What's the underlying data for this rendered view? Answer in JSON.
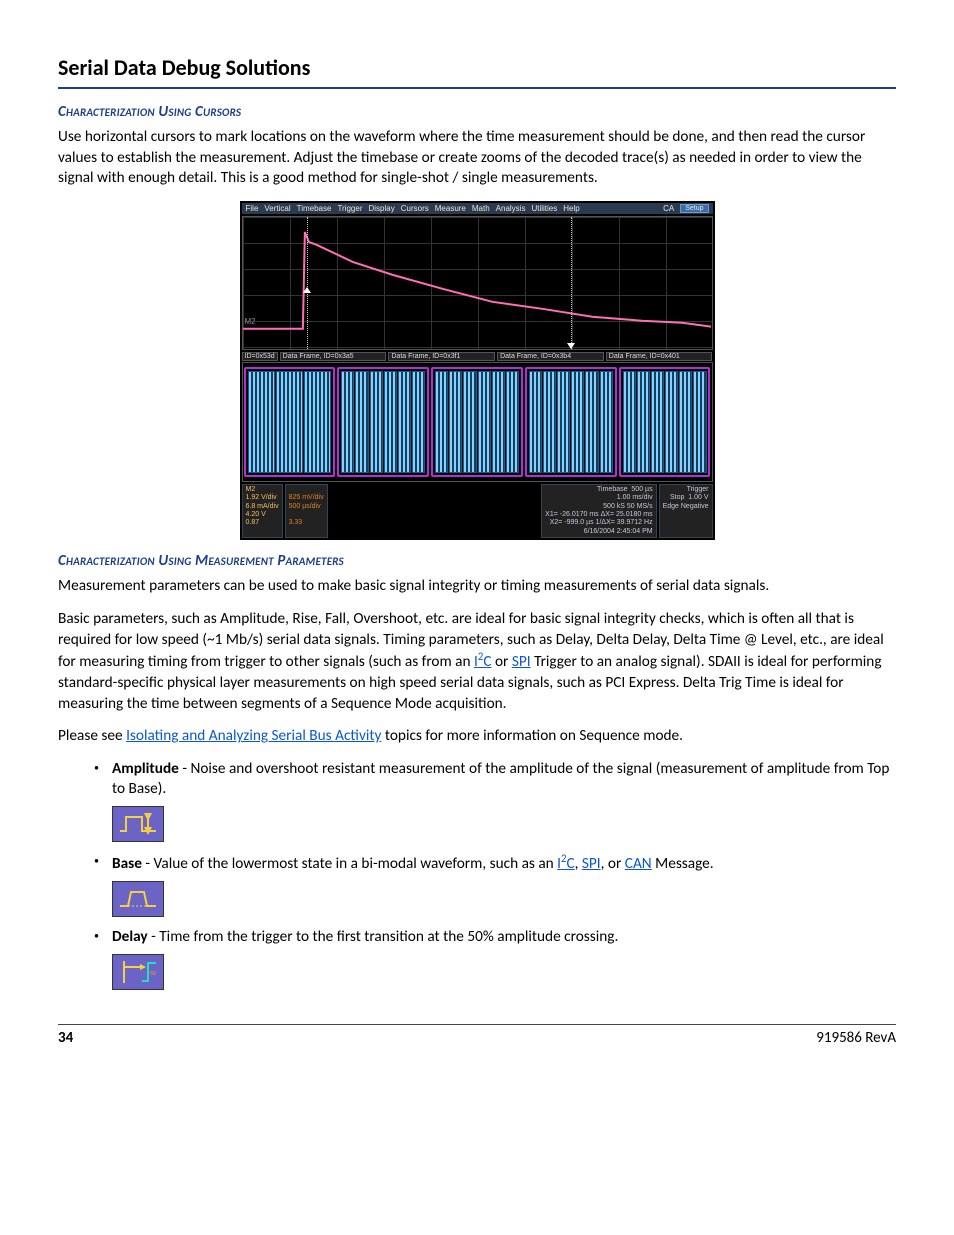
{
  "title": "Serial Data Debug Solutions",
  "section1": {
    "heading": "Characterization Using Cursors",
    "para": "Use horizontal cursors to mark locations on the waveform where the time measurement should be done, and then read the cursor values to establish the measurement. Adjust the timebase or create zooms of the decoded trace(s) as needed in order to view the signal with enough detail. This is a good method for single-shot / single measurements."
  },
  "scope": {
    "menu": [
      "File",
      "Vertical",
      "Timebase",
      "Trigger",
      "Display",
      "Cursors",
      "Measure",
      "Math",
      "Analysis",
      "Utilities",
      "Help"
    ],
    "ca": "CA",
    "setup": "Setup",
    "m2_label": "M2",
    "frames": [
      "ID=0x53d",
      "Data Frame, ID=0x3a5",
      "Data Frame, ID=0x3f1",
      "Data Frame, ID=0x3b4",
      "Data Frame, ID=0x401"
    ],
    "bottom_left": {
      "label": "M2",
      "v": "1.92 V/div",
      "ma": "6.8 mA/div",
      "v2": "4.20 V",
      "a": "0.87",
      "other1": "825 mV/div",
      "other2": "500 µs/div",
      "other3": "3.33"
    },
    "timebase": {
      "label": "Timebase",
      "val": "500 µs",
      "l1": "1.00 ms/div",
      "l2": "500 kS   50 MS/s",
      "x1": "X1= -26.0170 ms   ΔX= 25.0180 ms",
      "x2": "X2=   -999.0 µs   1/ΔX= 39.9712 Hz",
      "ts": "6/16/2004 2:45:04 PM"
    },
    "trigger": {
      "label": "Trigger",
      "mode": "Stop",
      "level": "1.00 V",
      "edge": "Edge   Negative"
    }
  },
  "section2": {
    "heading": "Characterization Using Measurement Parameters",
    "p1": "Measurement parameters can be used to make basic signal integrity or timing measurements of serial data signals.",
    "p2a": "Basic parameters, such as Amplitude, Rise, Fall, Overshoot, etc. are ideal for basic signal integrity checks, which is often all that is required for low speed (~1 Mb/s) serial data signals. Timing parameters, such as Delay, Delta Delay, Delta Time @ Level, etc., are ideal for measuring timing from trigger to other signals (such as from an ",
    "p2b": " or ",
    "p2c": " Trigger to an analog signal). SDAII is ideal for performing standard-specific physical layer measurements on high speed serial data signals, such as PCI Express. Delta Trig Time is ideal for measuring the time between segments of a Sequence Mode acisition.",
    "p2c_fixed": " Trigger to an analog signal). SDAII is ideal for performing standard-specific physical layer measurements on high speed serial data signals, such as PCI Express. Delta Trig Time is ideal for measuring the time between segments of a Sequence Mode acquisition.",
    "p3a": "Please see ",
    "p3b": " topics for more information on Sequence mode.",
    "link_isolating": "Isolating and Analyzing Serial Bus Activity",
    "link_i2c": "I",
    "link_i2c_sup": "2",
    "link_i2c_tail": "C",
    "link_spi": "SPI",
    "link_can": "CAN"
  },
  "bullets": {
    "amp": {
      "term": "Amplitude",
      "text": " - Noise and overshoot resistant measurement of the amplitude of the signal (measurement of amplitude from Top to Base)."
    },
    "base": {
      "term": "Base",
      "text_a": " - Value of the lowermost state in a bi-modal waveform, such as an ",
      "text_b": ", ",
      "text_c": ", or ",
      "text_d": " Message."
    },
    "delay": {
      "term": "Delay",
      "text": " - Time from the trigger to the first transition at the 50% amplitude crossing."
    }
  },
  "footer": {
    "page": "34",
    "rev": "919586 RevA"
  }
}
